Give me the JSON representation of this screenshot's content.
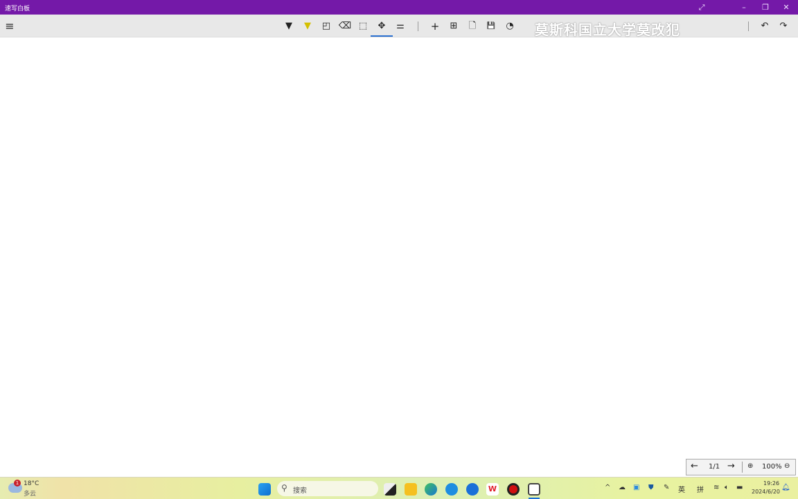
{
  "window": {
    "title": "速写白板",
    "controls": [
      "fullscreen-icon",
      "minimize-icon",
      "restore-icon",
      "close-icon"
    ]
  },
  "toolbar": {
    "tools": [
      {
        "name": "pen",
        "icon": "▼"
      },
      {
        "name": "highlighter",
        "icon": "▼"
      },
      {
        "name": "shapes",
        "icon": "◰"
      },
      {
        "name": "eraser",
        "icon": "⌫"
      },
      {
        "name": "select",
        "icon": "⬚"
      },
      {
        "name": "pan",
        "icon": "✥"
      },
      {
        "name": "settings",
        "icon": "⚌"
      },
      {
        "name": "add-page",
        "icon": "+"
      },
      {
        "name": "grid",
        "icon": "⊞"
      },
      {
        "name": "new-file",
        "icon": "🗋"
      },
      {
        "name": "save",
        "icon": "💾"
      },
      {
        "name": "export",
        "icon": "◔"
      }
    ],
    "active_tool": "pan",
    "undo": "↶",
    "redo": "↷"
  },
  "watermark": "莫斯科国立大学莫改犯",
  "page_nav": {
    "prev": "←",
    "page": "1/1",
    "next": "→",
    "zoom_in": "⊕",
    "zoom": "100%",
    "zoom_out": "⊖"
  },
  "taskbar": {
    "weather": {
      "temp": "18°C",
      "desc": "多云",
      "badge": "1"
    },
    "search_placeholder": "搜索",
    "apps": [
      "task-view",
      "file-explorer",
      "edge",
      "browser",
      "feishu",
      "wps",
      "recorder",
      "whiteboard"
    ],
    "tray": {
      "ime1": "英",
      "ime2": "拼",
      "time": "19:26",
      "date": "2024/6/20"
    }
  },
  "colors": {
    "titlebar": "#7419a8",
    "active_underline": "#2a6fd0"
  }
}
